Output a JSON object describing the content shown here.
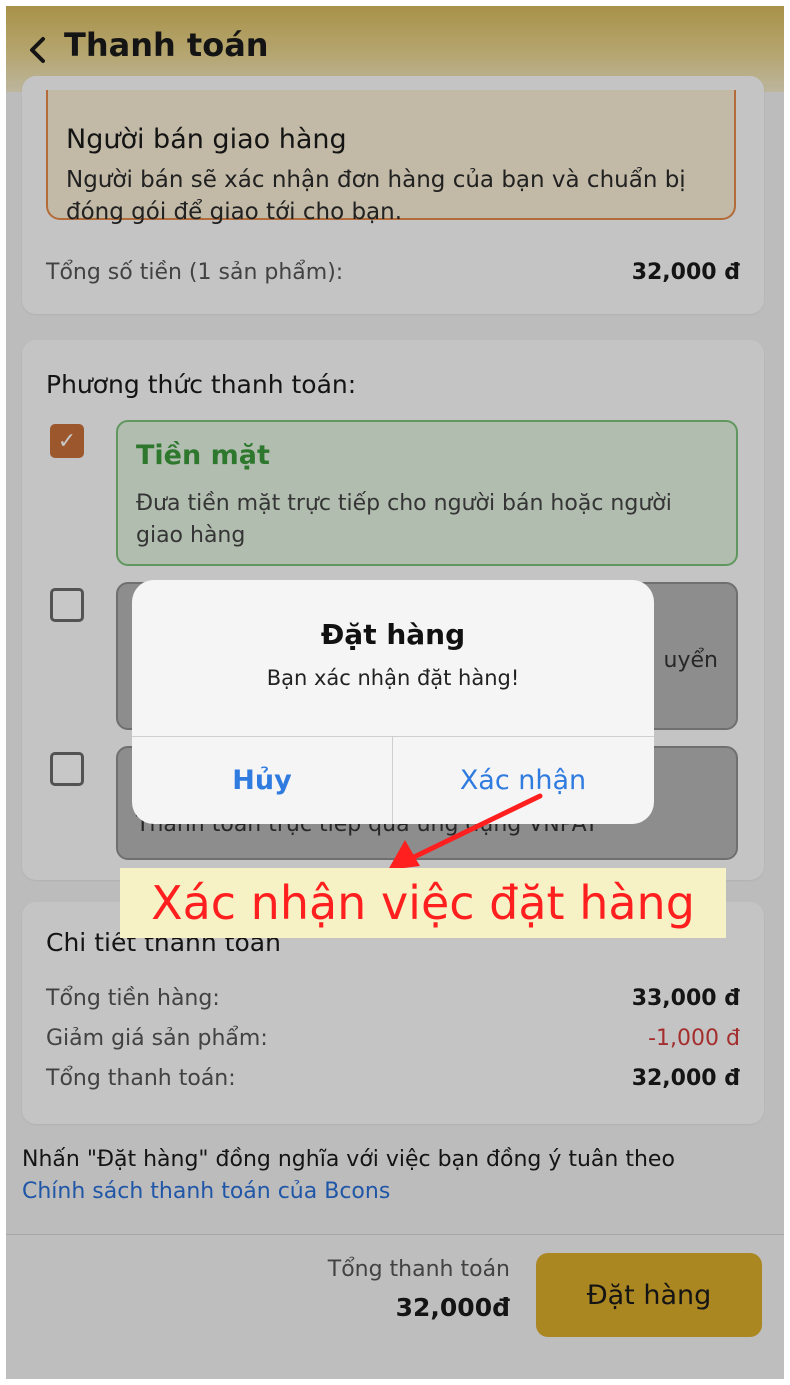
{
  "header": {
    "title": "Thanh toán"
  },
  "delivery": {
    "title": "Người bán giao hàng",
    "desc": "Người bán sẽ xác nhận đơn hàng của bạn và chuẩn bị đóng gói để giao tới cho bạn.",
    "total_label": "Tổng số tiền (1 sản phẩm):",
    "total_value": "32,000 đ"
  },
  "payment": {
    "title": "Phương thức thanh toán:",
    "cash_title": "Tiền mặt",
    "cash_desc": "Đưa tiền mặt trực tiếp cho người bán hoặc người giao hàng",
    "cash_check": "✓",
    "transfer_tail": "uyển",
    "vnpay_desc": "Thanh toán trực tiếp qua ứng dụng VNPAY"
  },
  "detail": {
    "title": "Chi tiết thanh toán",
    "rows": [
      {
        "label": "Tổng tiền hàng:",
        "value": "33,000 đ"
      },
      {
        "label": "Giảm giá sản phẩm:",
        "value": "-1,000 đ"
      },
      {
        "label": "Tổng thanh toán:",
        "value": "32,000 đ"
      }
    ]
  },
  "terms": {
    "text": "Nhấn \"Đặt hàng\" đồng nghĩa với việc bạn đồng ý tuân theo",
    "link": "Chính sách thanh toán của Bcons"
  },
  "bottom": {
    "total_label": "Tổng thanh toán",
    "total_value": "32,000đ",
    "order_label": "Đặt hàng"
  },
  "dialog": {
    "title": "Đặt hàng",
    "message": "Bạn xác nhận đặt hàng!",
    "cancel": "Hủy",
    "confirm": "Xác nhận"
  },
  "annotation": {
    "text": "Xác nhận việc đặt hàng",
    "color": "#ff1f1f"
  },
  "icons": {
    "back": "chevron-left-icon",
    "check": "check-icon"
  }
}
